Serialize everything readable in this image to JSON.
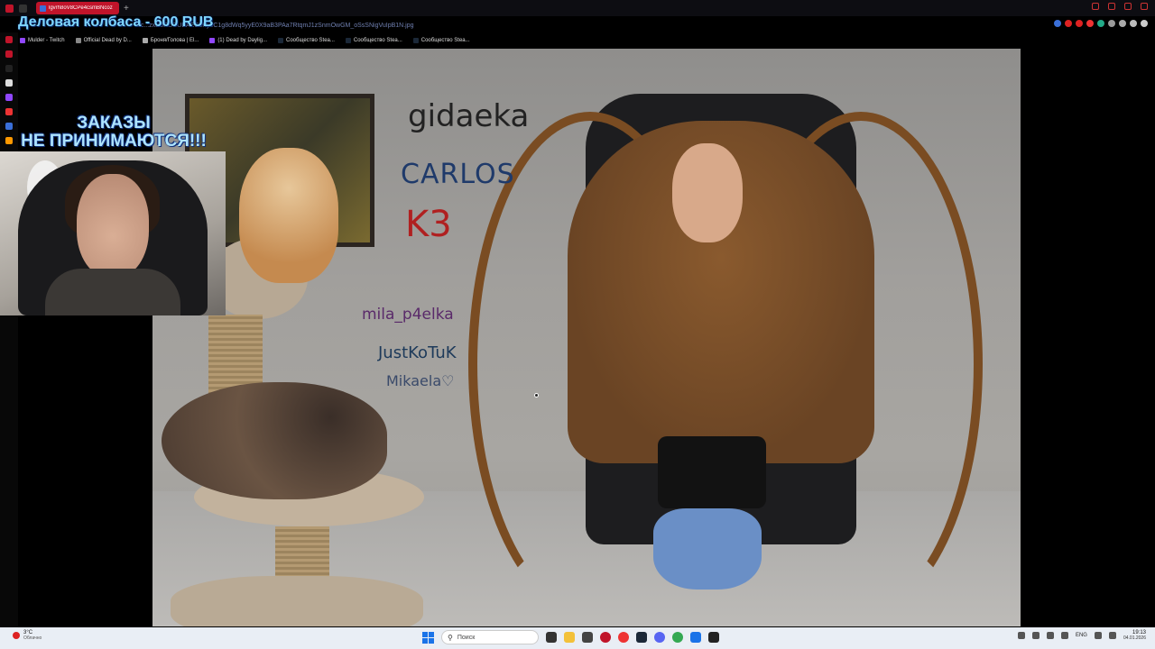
{
  "browser": {
    "tab_title": "lgvrh8oV8CPe4csmBNcoz",
    "url": "...c...zxulJRUCUBAEC6KyeC1g8dWq5yyE0X9aB3PAa7RtqmJ1zSnmOwGM_oSsSNigVuIpB1N.jpg",
    "bookmarks": [
      {
        "label": "Mulder - Twitch"
      },
      {
        "label": "Official Dead by D..."
      },
      {
        "label": "Броня/Голова | El..."
      },
      {
        "label": "(1) Dead by Daylig..."
      },
      {
        "label": "Сообщество Stea..."
      },
      {
        "label": "Сообщество Stea..."
      },
      {
        "label": "Сообщество Stea..."
      }
    ]
  },
  "overlay": {
    "donation_title": "Деловая колбаса - 600 RUB",
    "warning_line1": "ЗАКАЗЫ",
    "warning_line2": "НЕ ПРИНИМАЮТСЯ!!!"
  },
  "image": {
    "wall_names": {
      "gidaeka": "gidaeka",
      "carlos": "CARLOS",
      "k3": "K3",
      "mila": "mila_p4elka",
      "just": "JustKoTuK",
      "mikaela": "Mikaela♡"
    }
  },
  "taskbar": {
    "weather_temp": "3°C",
    "weather_condition": "Облачно",
    "search_placeholder": "Поиск",
    "language": "ENG",
    "time": "19:13",
    "date": "04.01.2026"
  },
  "colors": {
    "tab_active": "#c0142a",
    "donation_text": "#7fd6ff",
    "robe": "#6a4424",
    "taskbar_bg": "#e9eef5"
  }
}
